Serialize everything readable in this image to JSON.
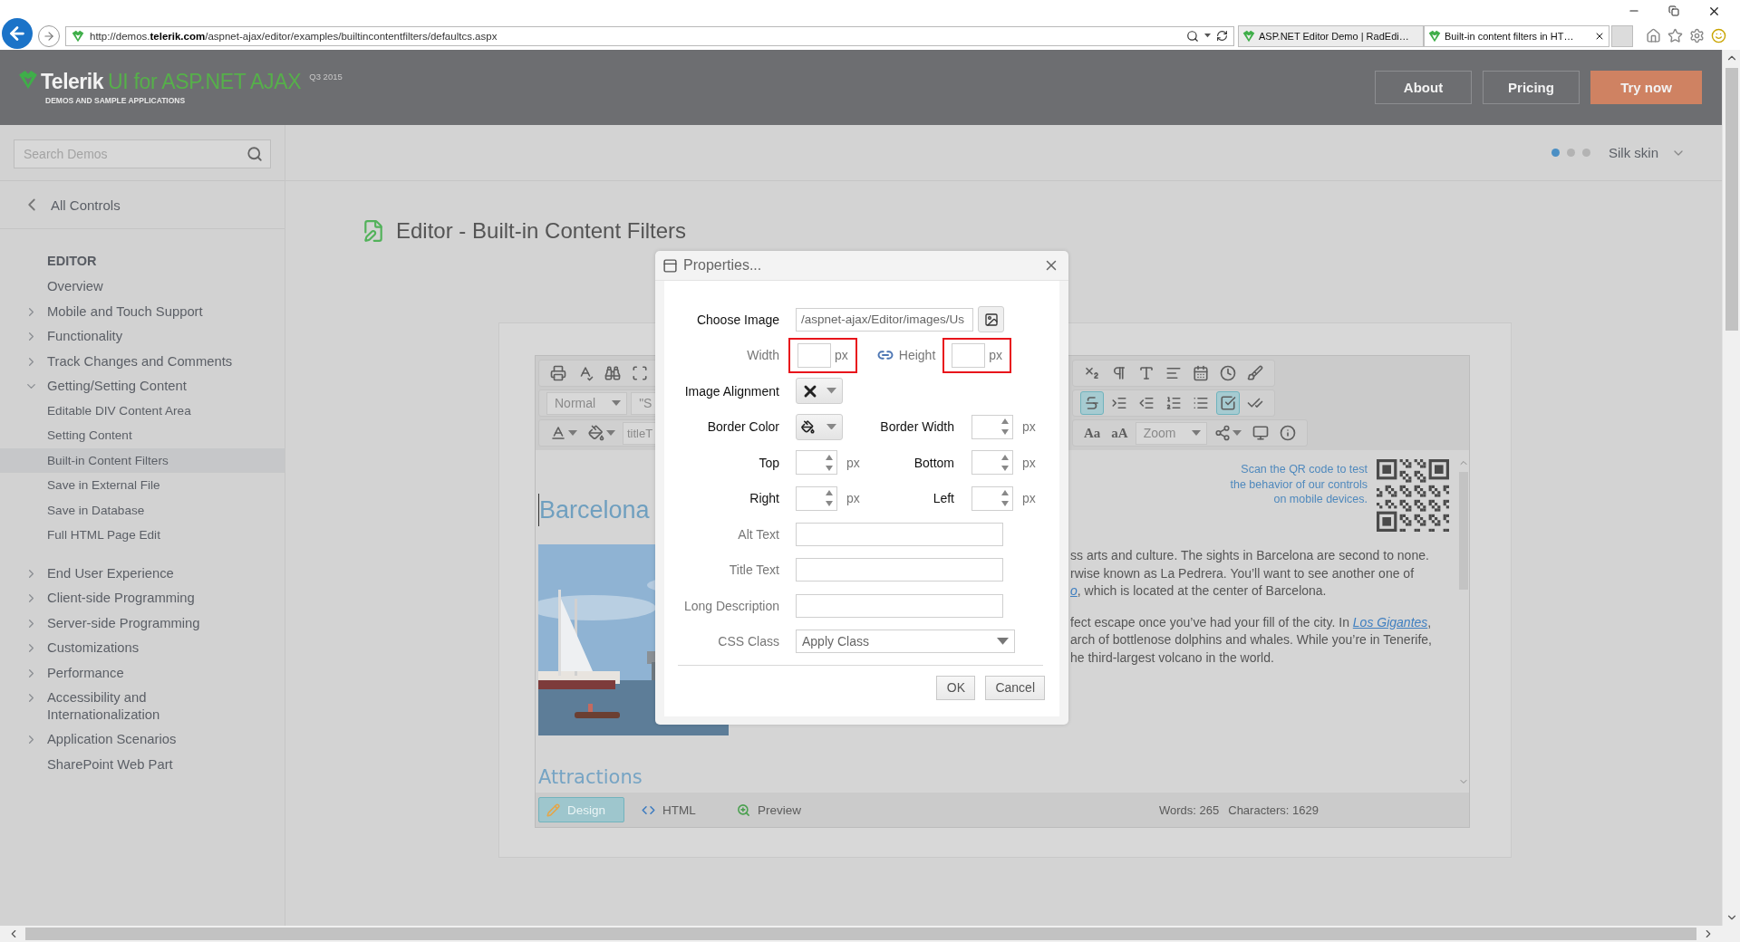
{
  "browser": {
    "address": "http://demos.**telerik.com**/aspnet-ajax/editor/examples/builtincontentfilters/defaultcs.aspx",
    "tabs": [
      {
        "title": "ASP.NET Editor Demo | RadEdi…",
        "selected": false
      },
      {
        "title": "Built-in content filters in HT…",
        "selected": true
      }
    ]
  },
  "header": {
    "brand": "Telerik",
    "product": "UI for ASP.NET AJAX",
    "version": "Q3 2015",
    "tagline": "DEMOS AND SAMPLE APPLICATIONS",
    "buttons": [
      {
        "label": "About",
        "kind": "outline"
      },
      {
        "label": "Pricing",
        "kind": "outline"
      },
      {
        "label": "Try now",
        "kind": "primary"
      }
    ]
  },
  "search": {
    "placeholder": "Search Demos"
  },
  "skin": {
    "dots": [
      {
        "selected": true
      },
      {
        "selected": false
      },
      {
        "selected": false
      }
    ],
    "label": "Silk skin"
  },
  "sidebar": {
    "back": "All Controls",
    "sections": [
      {
        "title": "EDITOR",
        "items": [
          {
            "label": "Overview",
            "kind": "page",
            "selected": false
          },
          {
            "label": "Mobile and Touch Support",
            "kind": "group",
            "expanded": false,
            "selected": false
          },
          {
            "label": "Functionality",
            "kind": "group",
            "expanded": false,
            "selected": false
          },
          {
            "label": "Track Changes and Comments",
            "kind": "group",
            "expanded": false,
            "selected": false
          },
          {
            "label": "Getting/Setting Content",
            "kind": "group",
            "expanded": true,
            "selected": false,
            "children": [
              {
                "label": "Editable DIV Content Area",
                "selected": false
              },
              {
                "label": "Setting Content",
                "selected": false
              },
              {
                "label": "Built-in Content Filters",
                "selected": true
              },
              {
                "label": "Save in External File",
                "selected": false
              },
              {
                "label": "Save in Database",
                "selected": false
              },
              {
                "label": "Full HTML Page Edit",
                "selected": false
              }
            ]
          }
        ]
      },
      {
        "items": [
          {
            "label": "End User Experience",
            "kind": "group",
            "expanded": false,
            "selected": false
          },
          {
            "label": "Client-side Programming",
            "kind": "group",
            "expanded": false,
            "selected": false
          },
          {
            "label": "Server-side Programming",
            "kind": "group",
            "expanded": false,
            "selected": false
          },
          {
            "label": "Customizations",
            "kind": "group",
            "expanded": false,
            "selected": false
          },
          {
            "label": "Performance",
            "kind": "group",
            "expanded": false,
            "selected": false
          },
          {
            "label": "Accessibility and Internationalization",
            "kind": "group",
            "expanded": false,
            "selected": false
          },
          {
            "label": "Application Scenarios",
            "kind": "group",
            "expanded": false,
            "selected": false
          },
          {
            "label": "SharePoint Web Part",
            "kind": "page",
            "selected": false
          }
        ]
      }
    ]
  },
  "page_title": "Editor - Built-in Content Filters",
  "editor": {
    "toolbar": [
      {
        "left": [
          {
            "kind": "print",
            "selected": false
          },
          {
            "kind": "spellcheck",
            "selected": false
          },
          {
            "kind": "find",
            "selected": false
          },
          {
            "kind": "select_all",
            "selected": false
          }
        ],
        "right": [
          {
            "kind": "subscript",
            "selected": false
          },
          {
            "kind": "paragraph",
            "selected": false
          },
          {
            "kind": "insert_text",
            "selected": false
          },
          {
            "kind": "align",
            "selected": false
          },
          {
            "kind": "template",
            "selected": false
          },
          {
            "kind": "date",
            "selected": false
          },
          {
            "kind": "clean",
            "selected": false
          }
        ]
      },
      {
        "left": [
          {
            "kind": "dropdown",
            "text": "Normal",
            "selected": false
          },
          {
            "kind": "dropdown",
            "text": "\"S",
            "selected": false
          }
        ],
        "right": [
          {
            "kind": "strike",
            "selected": true
          },
          {
            "kind": "indent",
            "selected": false
          },
          {
            "kind": "outdent",
            "selected": false
          },
          {
            "kind": "ordered_list",
            "selected": false
          },
          {
            "kind": "bullet_list",
            "selected": false
          },
          {
            "kind": "borders",
            "selected": true
          },
          {
            "kind": "validate",
            "selected": false
          }
        ]
      },
      {
        "left": [
          {
            "kind": "fore_color",
            "selected": false
          },
          {
            "kind": "back_color",
            "selected": false
          },
          {
            "kind": "field",
            "text": "titleT",
            "selected": false
          }
        ],
        "right": [
          {
            "kind": "text",
            "text": "Aa",
            "selected": false
          },
          {
            "kind": "text",
            "text": "aA",
            "selected": false
          },
          {
            "kind": "dropdown",
            "text": "Zoom",
            "selected": false
          },
          {
            "kind": "modules",
            "selected": false
          },
          {
            "kind": "preview",
            "selected": false
          },
          {
            "kind": "info",
            "selected": false
          }
        ]
      }
    ],
    "heading": "Barcelona",
    "subheading": "Attractions",
    "qr_note": [
      "Scan the QR code to test",
      "the behavior of our controls",
      "on mobile devices."
    ],
    "paragraphs": [
      [
        [
          {
            "text": "ss arts and culture. The sights in Barcelona are second to none."
          }
        ],
        [
          {
            "text": "rwise known as La Pedrera. You’ll want to see another one of"
          }
        ],
        [
          {
            "link": "o"
          },
          {
            "text": ", which is located at the center of Barcelona."
          }
        ]
      ],
      [
        [
          {
            "text": "fect escape once you’ve had your fill of the city. In "
          },
          {
            "link": "Los Gigantes"
          },
          {
            "text": ","
          }
        ],
        [
          {
            "text": "arch of bottlenose dolphins and whales. While you’re in Tenerife,"
          }
        ],
        [
          {
            "text": "he third-largest volcano in the world."
          }
        ]
      ]
    ],
    "modes": [
      {
        "label": "Design",
        "kind": "design",
        "selected": true
      },
      {
        "label": "HTML",
        "kind": "html",
        "selected": false
      },
      {
        "label": "Preview",
        "kind": "preview",
        "selected": false
      }
    ],
    "stats": [
      "Words: 265",
      "Characters: 1629"
    ]
  },
  "dialog": {
    "title": "Properties...",
    "rows": [
      {
        "kind": "image_path",
        "label": "Choose Image",
        "dimmed": false,
        "value": "/aspnet-ajax/Editor/images/Us"
      },
      {
        "kind": "size",
        "label": "Width",
        "dimmed": true,
        "unit": "px",
        "highlighted": true,
        "second": {
          "label": "Height",
          "dimmed": true,
          "unit": "px",
          "highlighted": true
        }
      },
      {
        "kind": "alignment_picker",
        "label": "Image Alignment",
        "dimmed": false
      },
      {
        "kind": "color_picker",
        "label": "Border Color",
        "dimmed": false,
        "second": {
          "label": "Border Width",
          "dimmed": false,
          "unit": "px"
        }
      },
      {
        "kind": "spin_pair",
        "label": "Top",
        "dimmed": false,
        "unit": "px",
        "second": {
          "label": "Bottom",
          "dimmed": false,
          "unit": "px"
        }
      },
      {
        "kind": "spin_pair",
        "label": "Right",
        "dimmed": false,
        "unit": "px",
        "second": {
          "label": "Left",
          "dimmed": false,
          "unit": "px"
        }
      },
      {
        "kind": "text",
        "label": "Alt Text",
        "dimmed": true
      },
      {
        "kind": "text",
        "label": "Title Text",
        "dimmed": true
      },
      {
        "kind": "text",
        "label": "Long Description",
        "dimmed": true
      },
      {
        "kind": "select",
        "label": "CSS Class",
        "dimmed": true,
        "value": "Apply Class"
      }
    ],
    "buttons": [
      "OK",
      "Cancel"
    ]
  }
}
